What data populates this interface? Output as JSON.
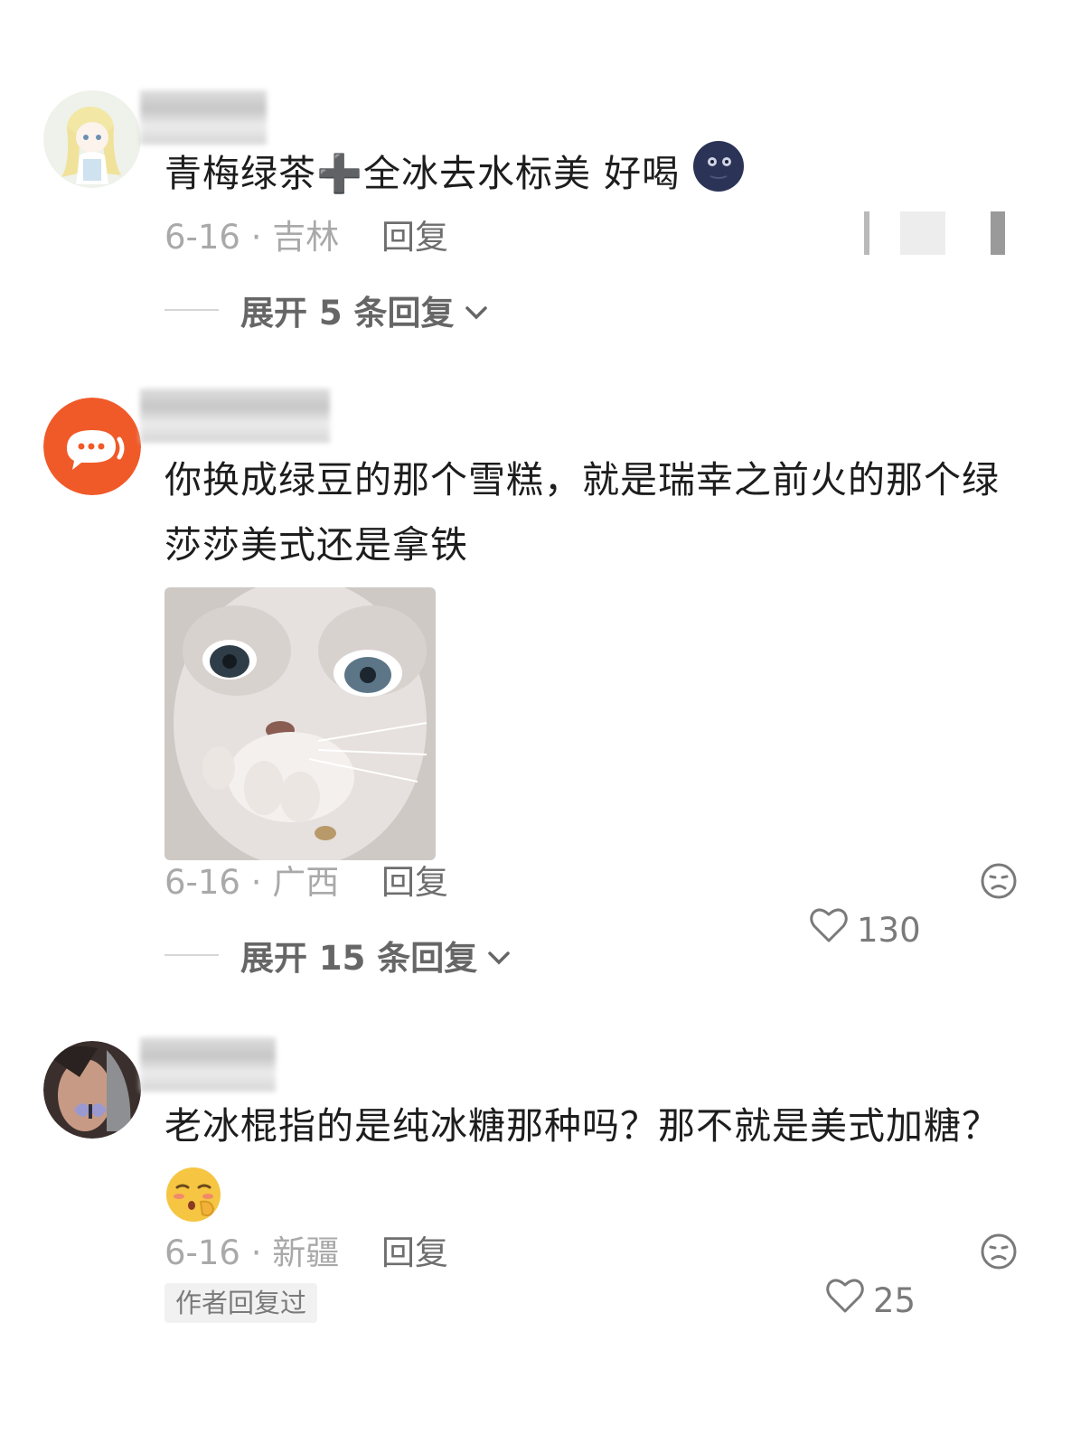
{
  "comments": [
    {
      "text": "青梅绿茶➕全冰去水标美 好喝",
      "date": "6-16",
      "location": "吉林",
      "reply_label": "回复",
      "expand_label": "展开 5 条回复"
    },
    {
      "text": "你换成绿豆的那个雪糕，就是瑞幸之前火的那个绿莎莎美式还是拿铁",
      "date": "6-16",
      "location": "广西",
      "reply_label": "回复",
      "likes": "130",
      "expand_label": "展开 15 条回复"
    },
    {
      "text": "老冰棍指的是纯冰糖那种吗？那不就是美式加糖？",
      "date": "6-16",
      "location": "新疆",
      "reply_label": "回复",
      "likes": "25",
      "author_tag": "作者回复过"
    }
  ],
  "icons": {
    "like": "heart-outline-icon",
    "dislike": "frown-face-icon",
    "expand": "chevron-down-icon",
    "moon": "new-moon-face-emoji",
    "shy": "blushing-face-emoji"
  },
  "colors": {
    "accent_avatar": "#f05a28",
    "meta_gray": "#a9a9a9",
    "text": "#1d1d1d"
  }
}
